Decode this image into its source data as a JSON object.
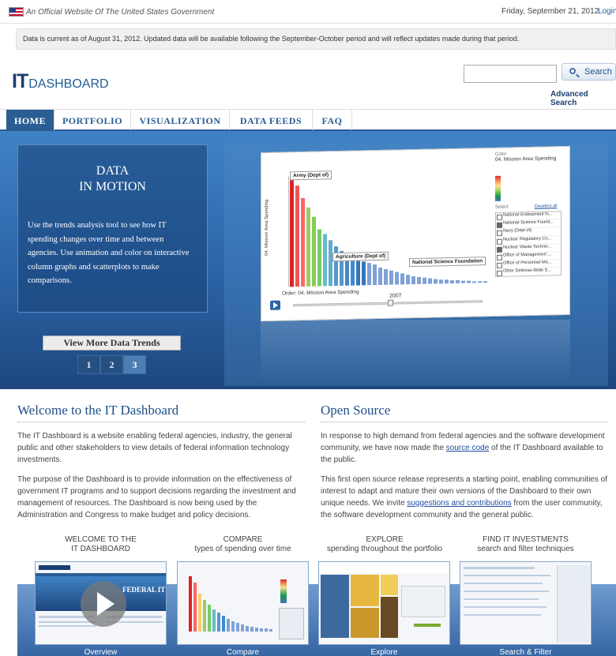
{
  "topbar": {
    "official": "An Official Website Of The United States Government",
    "date": "Friday, September 21, 2012",
    "login": "Login"
  },
  "notice": "Data is current as of August 31, 2012. Updated data will be available following the September-October period and will reflect updates made during that period.",
  "logo": {
    "it": "IT",
    "dashboard": "DASHBOARD"
  },
  "search": {
    "placeholder": "",
    "button": "Search",
    "advanced": "Advanced Search"
  },
  "nav": [
    {
      "label": "HOME",
      "active": true
    },
    {
      "label": "PORTFOLIO"
    },
    {
      "label": "VISUALIZATION"
    },
    {
      "label": "DATA FEEDS"
    },
    {
      "label": "FAQ"
    }
  ],
  "hero": {
    "title_line1": "DATA",
    "title_line2": "IN MOTION",
    "text": "Use the trends analysis tool to see how IT spending changes over time and between agencies. Use animation and color on interactive column graphs and scatterplots to make comparisons.",
    "button": "View More Data Trends",
    "pages": [
      "1",
      "2",
      "3"
    ],
    "active_page": "3",
    "chart": {
      "ylabel": "04. Mission Area Spending",
      "callouts": [
        "Army (Dept of)",
        "Agriculture (Dept of)",
        "National Science Foundation"
      ],
      "order_label": "Order: 04. Mission Area Spending",
      "year": "2007",
      "color_label": "Color",
      "color_value": "04. Mission Area Spending",
      "select_label": "Select",
      "deselect_label": "Deselect all",
      "list": [
        {
          "label": "National Endowment fo...",
          "checked": false
        },
        {
          "label": "National Science Found...",
          "checked": true
        },
        {
          "label": "Navy (Dept of)",
          "checked": false
        },
        {
          "label": "Nuclear Regulatory Co...",
          "checked": false
        },
        {
          "label": "Nuclear Waste Technic...",
          "checked": true
        },
        {
          "label": "Office of Management ...",
          "checked": false
        },
        {
          "label": "Office of Personnel Ma...",
          "checked": false
        },
        {
          "label": "Other Defense-Wide S...",
          "checked": false
        }
      ]
    }
  },
  "welcome": {
    "title": "Welcome to the IT Dashboard",
    "p1": "The IT Dashboard is a website enabling federal agencies, industry, the general public and other stakeholders to view details of federal information technology investments.",
    "p2": "The purpose of the Dashboard is to provide information on the effectiveness of government IT programs and to support decisions regarding the investment and management of resources. The Dashboard is now being used by the Administration and Congress to make budget and policy decisions."
  },
  "opensource": {
    "title": "Open Source",
    "p1_before": "In response to high demand from federal agencies and the software development community, we have now made the ",
    "p1_link": "source code",
    "p1_after": " of the IT Dashboard available to the public.",
    "p2_before": "This first open source release represents a starting point, enabling communities of interest to adapt and mature their own versions of the Dashboard to their own unique needs. We invite ",
    "p2_link": "suggestions and contributions",
    "p2_after": " from the user community, the software development community and the general public."
  },
  "thumbs": [
    {
      "cap1": "WELCOME TO THE",
      "cap2": "IT DASHBOARD",
      "label": "Overview",
      "inner_title": "FEDERAL IT"
    },
    {
      "cap1": "COMPARE",
      "cap2": "types of spending over time",
      "label": "Compare"
    },
    {
      "cap1": "EXPLORE",
      "cap2": "spending throughout the portfolio",
      "label": "Explore"
    },
    {
      "cap1": "FIND IT INVESTMENTS",
      "cap2": "search and filter techniques",
      "label": "Search & Filter"
    }
  ]
}
